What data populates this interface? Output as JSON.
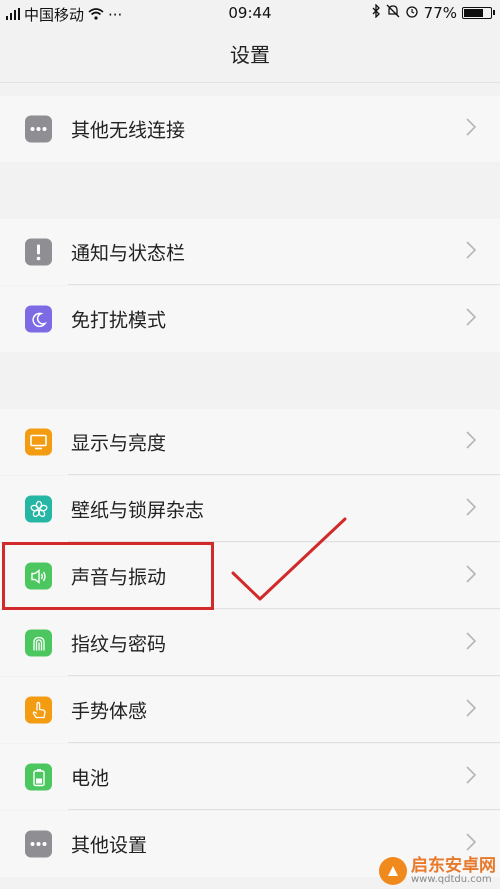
{
  "status_bar": {
    "carrier": "中国移动",
    "more": "···",
    "time": "09:44",
    "battery_text": "77%",
    "battery_level": 0.77
  },
  "header": {
    "title": "设置"
  },
  "items": [
    {
      "label": "其他无线连接",
      "icon": "more-dots-icon",
      "color": "#8e8e93"
    },
    {
      "label": "通知与状态栏",
      "icon": "exclamation-icon",
      "color": "#8e8e93"
    },
    {
      "label": "免打扰模式",
      "icon": "moon-icon",
      "color": "#7d6be6"
    },
    {
      "label": "显示与亮度",
      "icon": "monitor-icon",
      "color": "#f39c12"
    },
    {
      "label": "壁纸与锁屏杂志",
      "icon": "flower-icon",
      "color": "#25b7a3"
    },
    {
      "label": "声音与振动",
      "icon": "speaker-icon",
      "color": "#4cc75f"
    },
    {
      "label": "指纹与密码",
      "icon": "fingerprint-icon",
      "color": "#4cc75f"
    },
    {
      "label": "手势体感",
      "icon": "hand-gesture-icon",
      "color": "#f39c12"
    },
    {
      "label": "电池",
      "icon": "battery-icon",
      "color": "#4cc75f"
    },
    {
      "label": "其他设置",
      "icon": "more-dots-icon",
      "color": "#8e8e93"
    }
  ],
  "annotation": {
    "color": "#d22a2a"
  },
  "watermark": {
    "title": "启东安卓网",
    "url": "www.qdtdu.com"
  }
}
